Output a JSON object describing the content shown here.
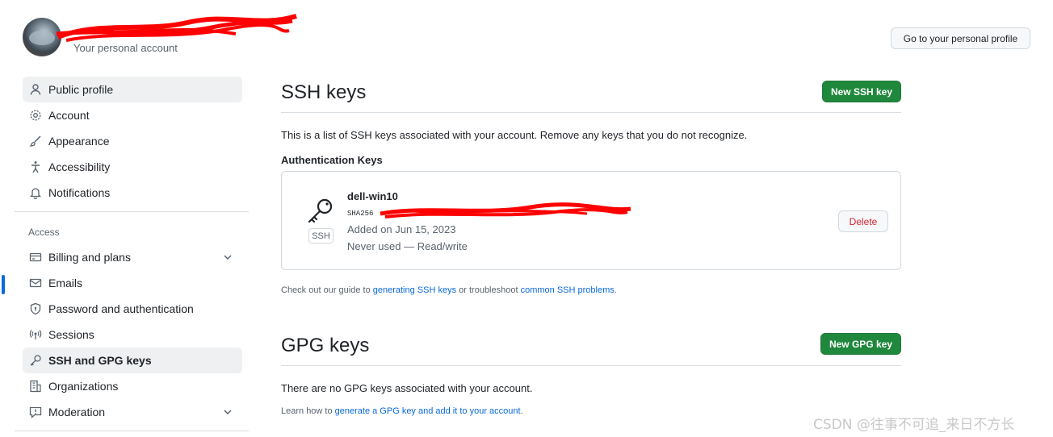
{
  "header": {
    "subtitle": "Your personal account",
    "profile_button": "Go to your personal profile"
  },
  "sidebar": {
    "items_top": [
      {
        "label": "Public profile",
        "icon": "person-icon"
      },
      {
        "label": "Account",
        "icon": "gear-icon"
      },
      {
        "label": "Appearance",
        "icon": "paintbrush-icon"
      },
      {
        "label": "Accessibility",
        "icon": "accessibility-icon"
      },
      {
        "label": "Notifications",
        "icon": "bell-icon"
      }
    ],
    "access_heading": "Access",
    "items_access": [
      {
        "label": "Billing and plans",
        "icon": "credit-card-icon"
      },
      {
        "label": "Emails",
        "icon": "mail-icon"
      },
      {
        "label": "Password and authentication",
        "icon": "shield-lock-icon"
      },
      {
        "label": "Sessions",
        "icon": "broadcast-icon"
      },
      {
        "label": "SSH and GPG keys",
        "icon": "key-icon"
      },
      {
        "label": "Organizations",
        "icon": "organization-icon"
      },
      {
        "label": "Moderation",
        "icon": "report-icon"
      }
    ]
  },
  "ssh": {
    "title": "SSH keys",
    "new_button": "New SSH key",
    "description": "This is a list of SSH keys associated with your account. Remove any keys that you do not recognize.",
    "auth_heading": "Authentication Keys",
    "key": {
      "name": "dell-win10",
      "fingerprint_prefix": "SHA256",
      "badge": "SSH",
      "added": "Added on Jun 15, 2023",
      "usage": "Never used — Read/write",
      "delete_button": "Delete"
    },
    "guide_prefix": "Check out our guide to ",
    "guide_link1": "generating SSH keys",
    "guide_mid": " or troubleshoot ",
    "guide_link2": "common SSH problems",
    "guide_suffix": "."
  },
  "gpg": {
    "title": "GPG keys",
    "new_button": "New GPG key",
    "empty_text": "There are no GPG keys associated with your account.",
    "learn_prefix": "Learn how to ",
    "learn_link": "generate a GPG key and add it to your account",
    "learn_suffix": "."
  },
  "watermark": "CSDN @往事不可追_来日不方长",
  "colors": {
    "accent": "#0969da",
    "primary_button": "#1f883d",
    "danger": "#d1242f",
    "redaction": "#ff0000"
  }
}
